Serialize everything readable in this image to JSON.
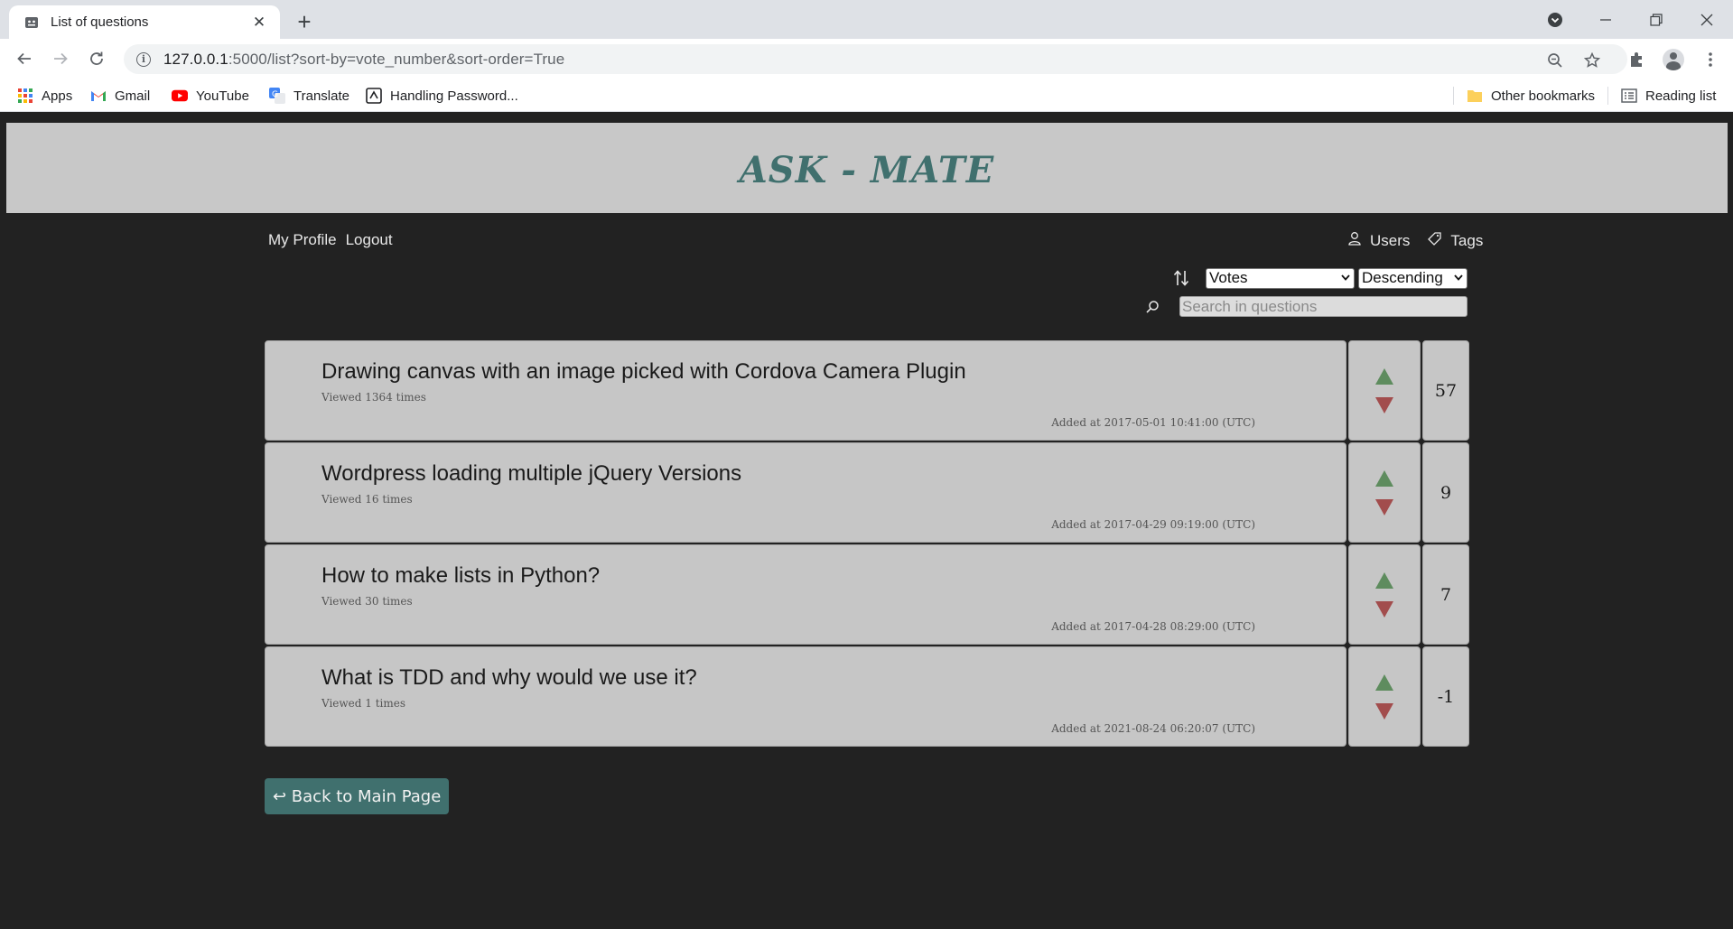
{
  "browser": {
    "tab_title": "List of questions",
    "tab_close": "✕",
    "new_tab": "+",
    "url_host": "127.0.0.1",
    "url_rest": ":5000/list?sort-by=vote_number&sort-order=True"
  },
  "bookmarks": [
    {
      "label": "Apps",
      "icon": "apps-grid-icon"
    },
    {
      "label": "Gmail",
      "icon": "gmail-icon"
    },
    {
      "label": "YouTube",
      "icon": "youtube-icon"
    },
    {
      "label": "Translate",
      "icon": "translate-icon"
    },
    {
      "label": "Handling Password...",
      "icon": "page-icon"
    }
  ],
  "bookmarks_right": {
    "other": "Other bookmarks",
    "reading_list": "Reading list"
  },
  "site": {
    "brand": "ASK - MATE",
    "nav_left": [
      "My Profile",
      "Logout"
    ],
    "nav_right": [
      "Users",
      "Tags"
    ],
    "sort_by": "Votes",
    "sort_order": "Descending",
    "search_placeholder": "Search in questions",
    "back_button": "↩ Back to Main Page"
  },
  "questions": [
    {
      "title": "Drawing canvas with an image picked with Cordova Camera Plugin",
      "views": "Viewed 1364 times",
      "added": "Added at 2017-05-01 10:41:00 (UTC)",
      "score": "57"
    },
    {
      "title": "Wordpress loading multiple jQuery Versions",
      "views": "Viewed 16 times",
      "added": "Added at 2017-04-29 09:19:00 (UTC)",
      "score": "9"
    },
    {
      "title": "How to make lists in Python?",
      "views": "Viewed 30 times",
      "added": "Added at 2017-04-28 08:29:00 (UTC)",
      "score": "7"
    },
    {
      "title": "What is TDD and why would we use it?",
      "views": "Viewed 1 times",
      "added": "Added at 2021-08-24 06:20:07 (UTC)",
      "score": "-1"
    }
  ],
  "colors": {
    "page_bg": "#222222",
    "banner_bg": "#c8c8c8",
    "brand": "#40706e",
    "card_bg": "#c6c6c6",
    "upvote": "#5e8c5e",
    "downvote": "#a24d4d"
  }
}
